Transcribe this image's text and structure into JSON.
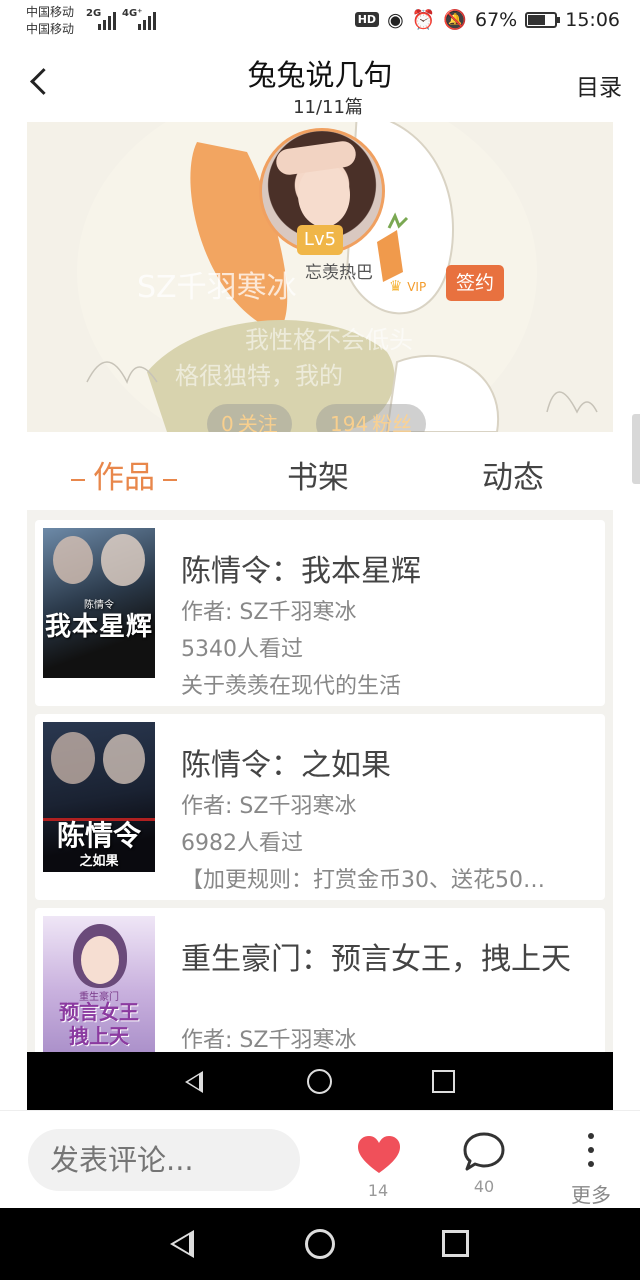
{
  "status_bar": {
    "carrier_1": "中国移动",
    "carrier_2": "中国移动",
    "network_1": "2G",
    "network_2": "4G⁺",
    "hd_badge": "HD",
    "battery_percent": "67%",
    "battery_level": 0.67,
    "time": "15:06"
  },
  "header": {
    "title": "兔兔说几句",
    "counter": "11/11篇",
    "toc_label": "目录"
  },
  "profile": {
    "level": "Lv5",
    "nickname": "SZ千羽寒冰",
    "hot_label": "忘羡热巴",
    "vip_label": "VIP",
    "sign_label": "签约",
    "bio_line_1": "我性格不会低头",
    "bio_line_2": "格很独特，我的",
    "following_count": "0",
    "following_label": "关注",
    "followers_count": "194",
    "followers_label": "粉丝"
  },
  "tabs": [
    {
      "label": "作品",
      "active": true
    },
    {
      "label": "书架",
      "active": false
    },
    {
      "label": "动态",
      "active": false
    }
  ],
  "works": [
    {
      "title": "陈情令：我本星辉",
      "author": "作者: SZ千羽寒冰",
      "views": "5340人看过",
      "desc": "关于羡羡在现代的生活",
      "cover_text": "我本星辉",
      "cover_sub": "陈情令"
    },
    {
      "title": "陈情令：之如果",
      "author": "作者: SZ千羽寒冰",
      "views": "6982人看过",
      "desc": "【加更规则：打赏金币30、送花50…",
      "cover_text": "陈情令",
      "cover_sub": "之如果"
    },
    {
      "title": "重生豪门：预言女王，拽上天",
      "author": "作者: SZ千羽寒冰",
      "views": "",
      "desc": "",
      "cover_text": "预言女王拽上天",
      "cover_sub": "重生豪门"
    }
  ],
  "action_bar": {
    "comment_placeholder": "发表评论...",
    "like_count": "14",
    "comment_count": "40",
    "more_label": "更多"
  },
  "colors": {
    "accent": "#e8874b",
    "sign": "#e8713f",
    "level": "#f0b648",
    "like": "#f0505a"
  }
}
